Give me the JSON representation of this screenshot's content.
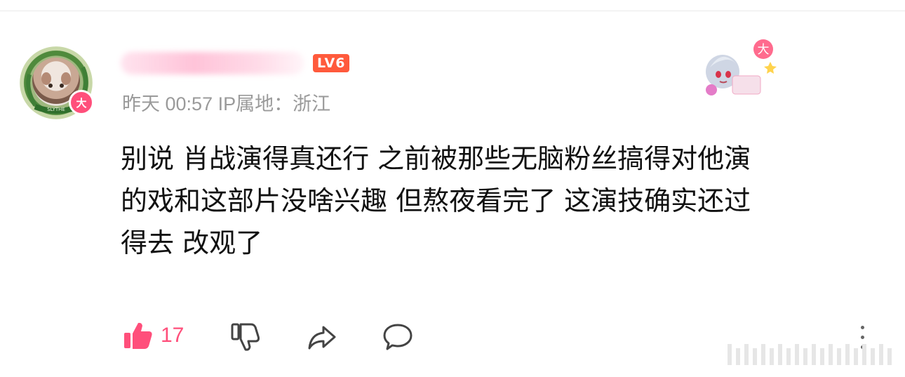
{
  "user": {
    "level_badge": "LV6",
    "avatar_badge_text": "大",
    "avatar_ribbon_text": "SLYTHE"
  },
  "meta": {
    "date": "昨天",
    "time": "00:57",
    "ip_label": "IP属地：",
    "ip_location": "浙江"
  },
  "sticker": {
    "badge_text": "大",
    "icon": "anime-character-sticker"
  },
  "comment": {
    "lines": [
      "别说 肖战演得真还行 之前被那些无脑粉丝搞得对他演",
      "的戏和这部片没啥兴趣 但熬夜看完了 这演技确实还过",
      "得去 改观了"
    ]
  },
  "actions": {
    "like_count": "17",
    "like_icon": "thumbs-up-icon",
    "dislike_icon": "thumbs-down-icon",
    "share_icon": "share-icon",
    "comment_icon": "comment-icon",
    "more_icon": "more-vertical-icon"
  },
  "colors": {
    "accent_pink": "#ff4f7b",
    "level_badge": "#ff5a3c",
    "meta_gray": "#9a9a9a",
    "text": "#111111"
  }
}
